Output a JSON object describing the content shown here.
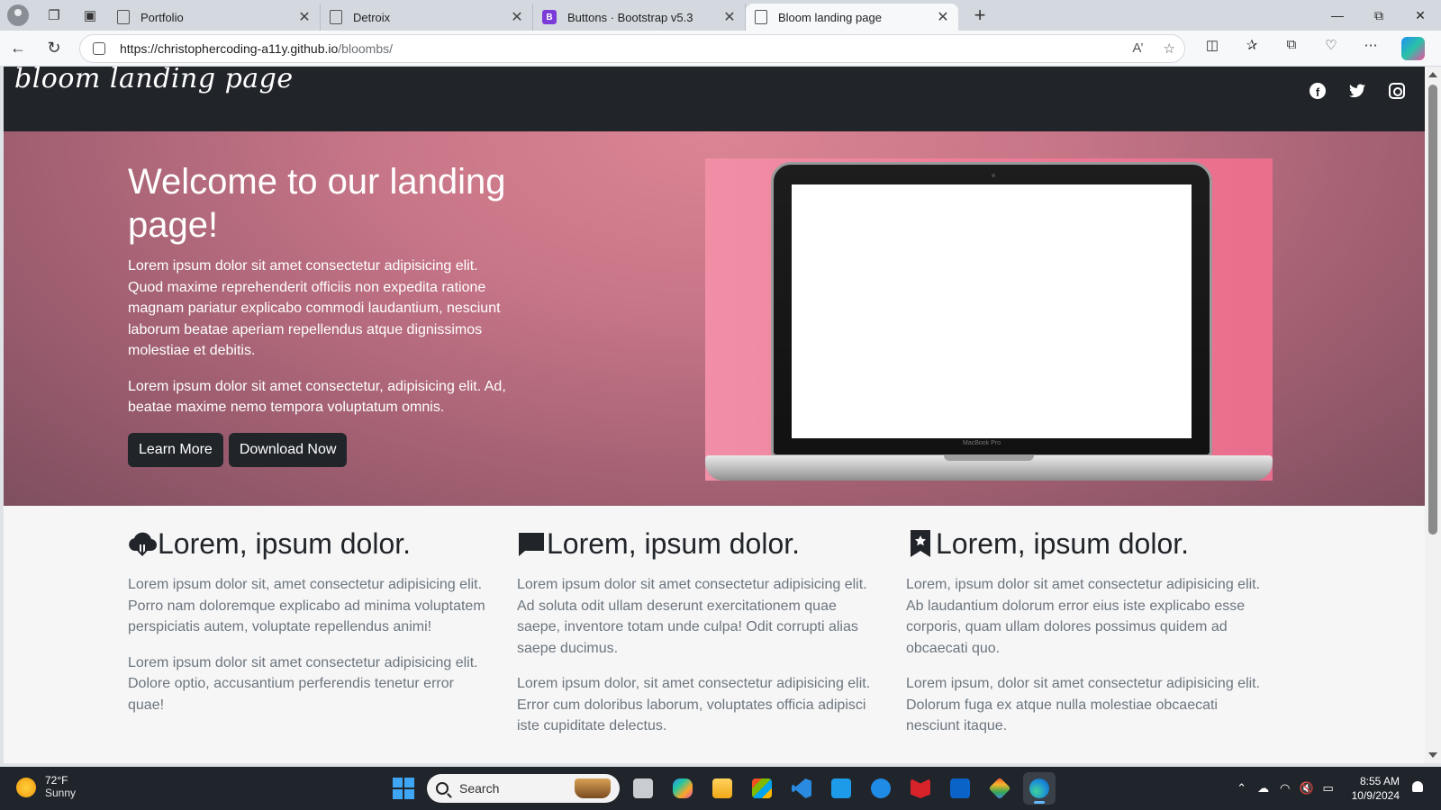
{
  "browser": {
    "tabs": [
      {
        "title": "Portfolio",
        "icon": "page-icon",
        "active": false
      },
      {
        "title": "Detroix",
        "icon": "page-icon",
        "active": false
      },
      {
        "title": "Buttons · Bootstrap v5.3",
        "icon": "bootstrap-icon",
        "active": false
      },
      {
        "title": "Bloom landing page",
        "icon": "page-icon",
        "active": true
      }
    ],
    "url_host": "https://christophercoding-a11y.github.io",
    "url_path": "/bloombs/"
  },
  "site": {
    "brand": "bloom landing page",
    "social": [
      "facebook-icon",
      "twitter-icon",
      "instagram-icon"
    ],
    "hero": {
      "title": "Welcome to our landing page!",
      "p1": "Lorem ipsum dolor sit amet consectetur adipisicing elit. Quod maxime reprehenderit officiis non expedita ratione magnam pariatur explicabo commodi laudantium, nesciunt laborum beatae aperiam repellendus atque dignissimos molestiae et debitis.",
      "p2": "Lorem ipsum dolor sit amet consectetur, adipisicing elit. Ad, beatae maxime nemo tempora voluptatum omnis.",
      "btn_learn": "Learn More",
      "btn_download": "Download Now",
      "laptop_label": "MacBook Pro"
    },
    "features": [
      {
        "icon": "cloud-download-icon",
        "title": "Lorem, ipsum dolor.",
        "p1": "Lorem ipsum dolor sit, amet consectetur adipisicing elit. Porro nam doloremque explicabo ad minima voluptatem perspiciatis autem, voluptate repellendus animi!",
        "p2": "Lorem ipsum dolor sit amet consectetur adipisicing elit. Dolore optio, accusantium perferendis tenetur error quae!"
      },
      {
        "icon": "chat-icon",
        "title": "Lorem, ipsum dolor.",
        "p1": "Lorem ipsum dolor sit amet consectetur adipisicing elit. Ad soluta odit ullam deserunt exercitationem quae saepe, inventore totam unde culpa! Odit corrupti alias saepe ducimus.",
        "p2": "Lorem ipsum dolor, sit amet consectetur adipisicing elit. Error cum doloribus laborum, voluptates officia adipisci iste cupiditate delectus."
      },
      {
        "icon": "bookmark-star-icon",
        "title": "Lorem, ipsum dolor.",
        "p1": "Lorem, ipsum dolor sit amet consectetur adipisicing elit. Ab laudantium dolorum error eius iste explicabo esse corporis, quam ullam dolores possimus quidem ad obcaecati quo.",
        "p2": "Lorem ipsum, dolor sit amet consectetur adipisicing elit. Dolorum fuga ex atque nulla molestiae obcaecati nesciunt itaque."
      }
    ]
  },
  "taskbar": {
    "weather_temp": "72°F",
    "weather_cond": "Sunny",
    "search_placeholder": "Search",
    "time": "8:55 AM",
    "date": "10/9/2024"
  },
  "colors": {
    "header_bg": "#212529",
    "hero_pink": "#c67587",
    "btn_dark": "#212529",
    "taskbar_bg": "#20252c"
  }
}
